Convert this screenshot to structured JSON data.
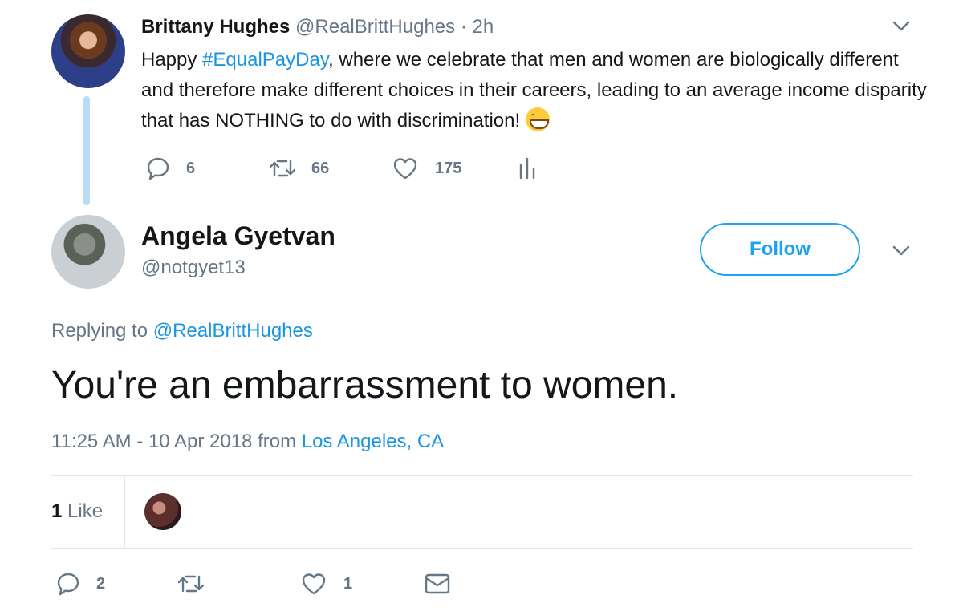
{
  "parent_tweet": {
    "author_name": "Brittany Hughes",
    "author_handle": "@RealBrittHughes",
    "separator": "·",
    "time": "2h",
    "text_before": "Happy ",
    "hashtag": "#EqualPayDay",
    "text_after": ", where we celebrate that men and women are biologically different and therefore make different choices in their careers, leading to an average income disparity that has NOTHING to do with discrimination! ",
    "emoji": "grinning-face-emoji",
    "replies": "6",
    "retweets": "66",
    "likes": "175"
  },
  "main_tweet": {
    "author_name": "Angela Gyetvan",
    "author_handle": "@notgyet13",
    "follow_label": "Follow",
    "replying_prefix": "Replying to ",
    "replying_to": "@RealBrittHughes",
    "text": "You're an embarrassment to women.",
    "timestamp": "11:25 AM - 10 Apr 2018 from ",
    "location": "Los Angeles, CA",
    "like_count": "1",
    "like_label": " Like",
    "replies": "2",
    "retweets": "",
    "likes": "1"
  },
  "colors": {
    "accent": "#1da1f2",
    "link": "#1b95e0",
    "muted": "#657786",
    "thread_line": "#b9dcf5"
  }
}
